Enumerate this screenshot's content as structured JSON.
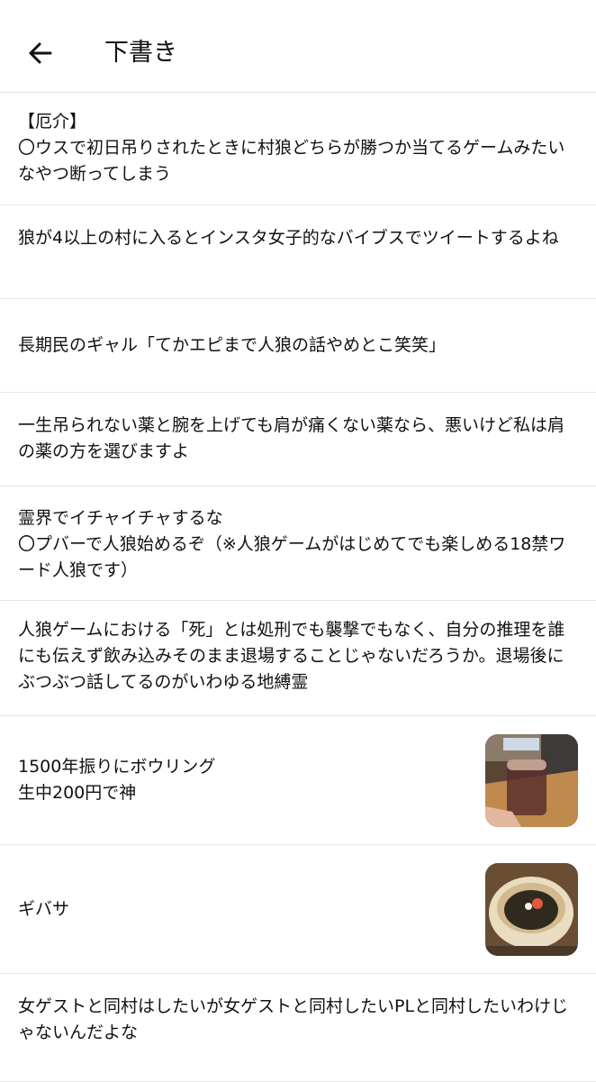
{
  "header": {
    "title": "下書き"
  },
  "drafts": [
    {
      "text": "【厄介】\n〇ウスで初日吊りされたときに村狼どちらが勝つか当てるゲームみたいなやつ断ってしまう"
    },
    {
      "text": "狼が4以上の村に入るとインスタ女子的なバイブスでツイートするよね"
    },
    {
      "text": "長期民のギャル「てかエピまで人狼の話やめとこ笑笑」"
    },
    {
      "text": "一生吊られない薬と腕を上げても肩が痛くない薬なら、悪いけど私は肩の薬の方を選びますよ"
    },
    {
      "text": "霊界でイチャイチャするな\n〇プバーで人狼始めるぞ（※人狼ゲームがはじめてでも楽しめる18禁ワード人狼です）"
    },
    {
      "text": "人狼ゲームにおける「死」とは処刑でも襲撃でもなく、自分の推理を誰にも伝えず飲み込みそのまま退場することじゃないだろうか。退場後にぶつぶつ話してるのがいわゆる地縛霊"
    },
    {
      "text": "1500年振りにボウリング\n生中200円で神",
      "thumbnail": "beer-at-bowling-alley-photo"
    },
    {
      "text": "ギバサ",
      "thumbnail": "gibasa-seaweed-bowl-photo"
    },
    {
      "text": "女ゲストと同村はしたいが女ゲストと同村したいPLと同村したいわけじゃないんだよな"
    }
  ]
}
